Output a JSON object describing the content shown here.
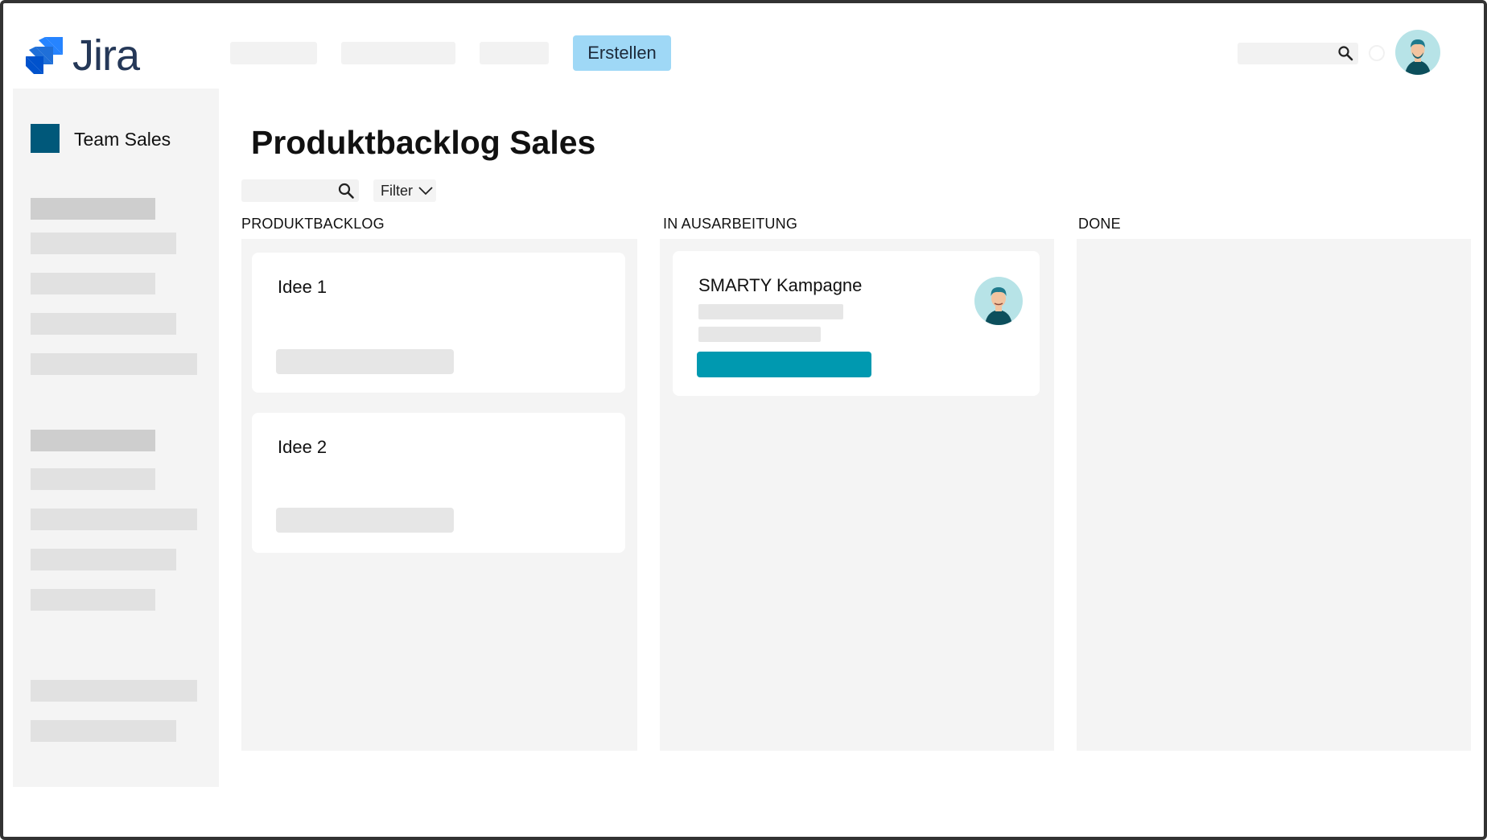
{
  "app": {
    "name": "Jira",
    "accent_color": "#0099b0",
    "create_button_label": "Erstellen",
    "create_button_color": "#9fd8f6",
    "logo_icon": "jira-logo-icon",
    "search_icon": "search-icon",
    "avatar_icon": "user-avatar-icon"
  },
  "sidebar": {
    "team_name": "Team Sales",
    "team_color": "#00587a"
  },
  "main": {
    "title": "Produktbacklog Sales",
    "filter_label": "Filter"
  },
  "board": {
    "columns": [
      {
        "title": "PRODUKTBACKLOG",
        "cards": [
          {
            "title": "Idee 1"
          },
          {
            "title": "Idee 2"
          }
        ]
      },
      {
        "title": "IN AUSARBEITUNG",
        "cards": [
          {
            "title": "SMARTY Kampagne",
            "status_color": "#0099b0"
          }
        ]
      },
      {
        "title": "DONE",
        "cards": []
      }
    ]
  }
}
